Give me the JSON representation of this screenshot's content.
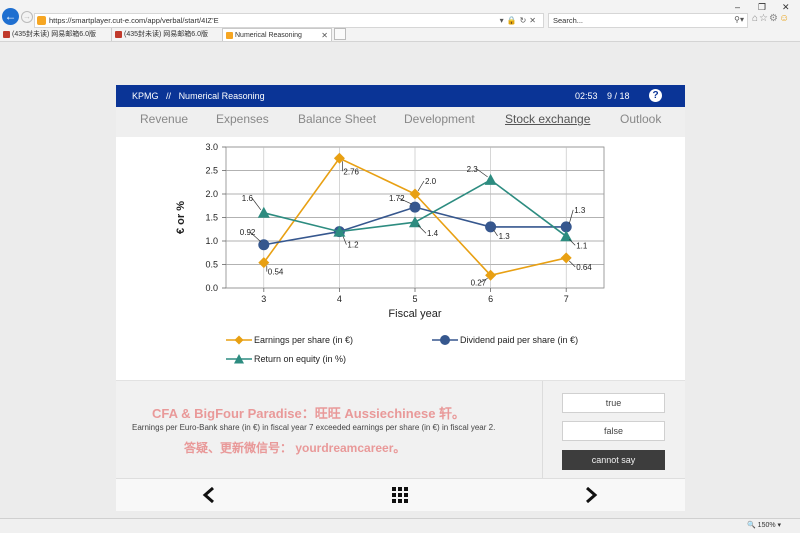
{
  "browser": {
    "url": "https://smartplayer.cut-e.com/app/verbal/start/4IZ’E",
    "search_placeholder": "Search...",
    "tabs": [
      {
        "label": "(435封未读) 网易邮箱6.0版"
      },
      {
        "label": "(435封未读) 网易邮箱6.0版"
      },
      {
        "label": "Numerical Reasoning"
      }
    ],
    "zoom": "150%"
  },
  "header": {
    "brand": "KPMG",
    "separator": "//",
    "title": "Numerical Reasoning",
    "timer": "02:53",
    "progress": "9 / 18",
    "help": "?"
  },
  "nav_tabs": [
    {
      "label": "Revenue"
    },
    {
      "label": "Expenses"
    },
    {
      "label": "Balance Sheet"
    },
    {
      "label": "Development"
    },
    {
      "label": "Stock exchange"
    },
    {
      "label": "Outlook"
    }
  ],
  "chart_data": {
    "type": "line",
    "x": [
      3,
      4,
      5,
      6,
      7
    ],
    "xlabel": "Fiscal year",
    "ylabel": "€ or %",
    "ylim": [
      0.0,
      3.0
    ],
    "yticks": [
      "0.0",
      "0.5",
      "1.0",
      "1.5",
      "2.0",
      "2.5",
      "3.0"
    ],
    "grid": true,
    "series": [
      {
        "name": "Earnings per share (in €)",
        "values": [
          0.54,
          2.76,
          2.0,
          0.27,
          0.64
        ],
        "labels": [
          "0.54",
          "2.76",
          "2.0",
          "0.27",
          "0.64"
        ],
        "color": "#e8a013",
        "marker": "diamond"
      },
      {
        "name": "Dividend paid per share (in €)",
        "values": [
          0.92,
          1.2,
          1.72,
          1.3,
          1.3
        ],
        "labels": [
          "0.92",
          "1.2",
          "1.72",
          "1.3",
          "1.3"
        ],
        "color": "#36578e",
        "marker": "circle"
      },
      {
        "name": "Return on equity (in %)",
        "values": [
          1.6,
          1.2,
          1.4,
          2.3,
          1.1
        ],
        "labels": [
          "1.6",
          "",
          "1.4",
          "2.3",
          "1.1"
        ],
        "color": "#2d8c80",
        "marker": "triangle"
      }
    ]
  },
  "question": {
    "watermark_line1": "CFA & BigFour Paradise：旺旺 Aussiechinese 轩。",
    "watermark_line2": "答疑、更新微信号： yourdreamcareer。",
    "text": "Earnings per Euro-Bank share (in €) in fiscal year 7 exceeded earnings per share (in €) in fiscal year 2."
  },
  "answers": {
    "true": "true",
    "false": "false",
    "cannot_say": "cannot say"
  },
  "colors": {
    "header_bg": "#0a3496",
    "earnings": "#e8a013",
    "dividend": "#36578e",
    "roe": "#2d8c80"
  }
}
